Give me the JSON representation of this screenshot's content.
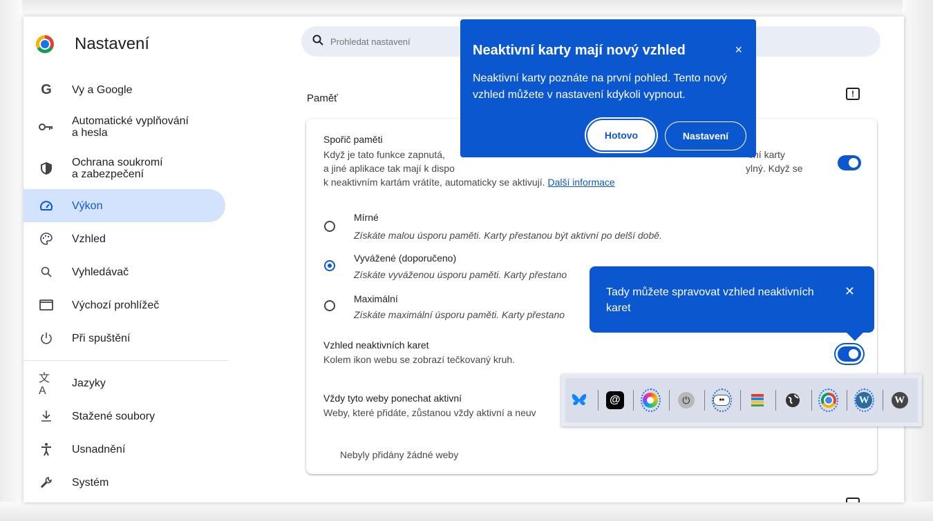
{
  "app": {
    "title": "Nastavení"
  },
  "search": {
    "placeholder": "Prohledat nastavení"
  },
  "nav": {
    "items": [
      {
        "label": "Vy a Google",
        "icon": "google-g-icon"
      },
      {
        "label": "Automatické vyplňování\na hesla",
        "icon": "key-icon"
      },
      {
        "label": "Ochrana soukromí\na zabezpečení",
        "icon": "shield-icon"
      },
      {
        "label": "Výkon",
        "icon": "speedometer-icon",
        "active": true
      },
      {
        "label": "Vzhled",
        "icon": "palette-icon"
      },
      {
        "label": "Vyhledávač",
        "icon": "search-icon"
      },
      {
        "label": "Výchozí prohlížeč",
        "icon": "browser-window-icon"
      },
      {
        "label": "Při spuštění",
        "icon": "power-icon"
      }
    ],
    "items2": [
      {
        "label": "Jazyky",
        "icon": "translate-icon"
      },
      {
        "label": "Stažené soubory",
        "icon": "download-icon"
      },
      {
        "label": "Usnadnění",
        "icon": "accessibility-icon"
      },
      {
        "label": "Systém",
        "icon": "wrench-icon"
      }
    ]
  },
  "main": {
    "section_title": "Paměť",
    "memory_saver": {
      "title": "Spořič paměti",
      "line1": "Když je tato funkce zapnutá,",
      "line1_end": "vní karty",
      "line2_start": "a jiné aplikace tak mají k dispo",
      "line2_end": "ylný. Když se",
      "line3": "k neaktivním kartám vrátíte, automaticky se aktivují.",
      "link": "Další informace",
      "enabled": true
    },
    "options": [
      {
        "label": "Mírné",
        "desc": "Získáte malou úsporu paměti. Karty přestanou být aktivní po delší době.",
        "checked": false
      },
      {
        "label": "Vyvážené (doporučeno)",
        "desc": "Získáte vyváženou úsporu paměti. Karty přestano",
        "checked": true
      },
      {
        "label": "Maximální",
        "desc": "Získáte maximální úsporu paměti. Karty přestano",
        "checked": false
      }
    ],
    "inactive_look": {
      "title": "Vzhled neaktivních karet",
      "desc": "Kolem ikon webu se zobrazí tečkovaný kruh.",
      "enabled": true
    },
    "always_active": {
      "title": "Vždy tyto weby ponechat aktivní",
      "desc": "Weby, které přidáte, zůstanou vždy aktivní a neuv",
      "empty": "Nebyly přidány žádné weby"
    }
  },
  "popup": {
    "title": "Neaktivní karty mají nový vzhled",
    "text": "Neaktivní karty poznáte na první pohled. Tento nový vzhled můžete v nastavení kdykoli vypnout.",
    "done_label": "Hotovo",
    "settings_label": "Nastavení",
    "close_glyph": "×"
  },
  "tooltip": {
    "text": "Tady můžete spravovat vzhled neaktivních karet",
    "close_glyph": "✕"
  },
  "tabstrip": {
    "tabs": [
      {
        "icon": "bluesky-butterfly-icon",
        "inactive": false
      },
      {
        "icon": "threads-icon",
        "inactive": false
      },
      {
        "icon": "color-ring-icon",
        "inactive": true
      },
      {
        "icon": "power-button-icon",
        "inactive": false
      },
      {
        "icon": "site-badge-icon",
        "inactive": true
      },
      {
        "icon": "books-icon",
        "inactive": false
      },
      {
        "icon": "globe-icon",
        "inactive": false
      },
      {
        "icon": "chrome-icon",
        "inactive": true
      },
      {
        "icon": "wordpress-icon",
        "inactive": true
      },
      {
        "icon": "wordpress-icon",
        "inactive": false
      }
    ]
  }
}
